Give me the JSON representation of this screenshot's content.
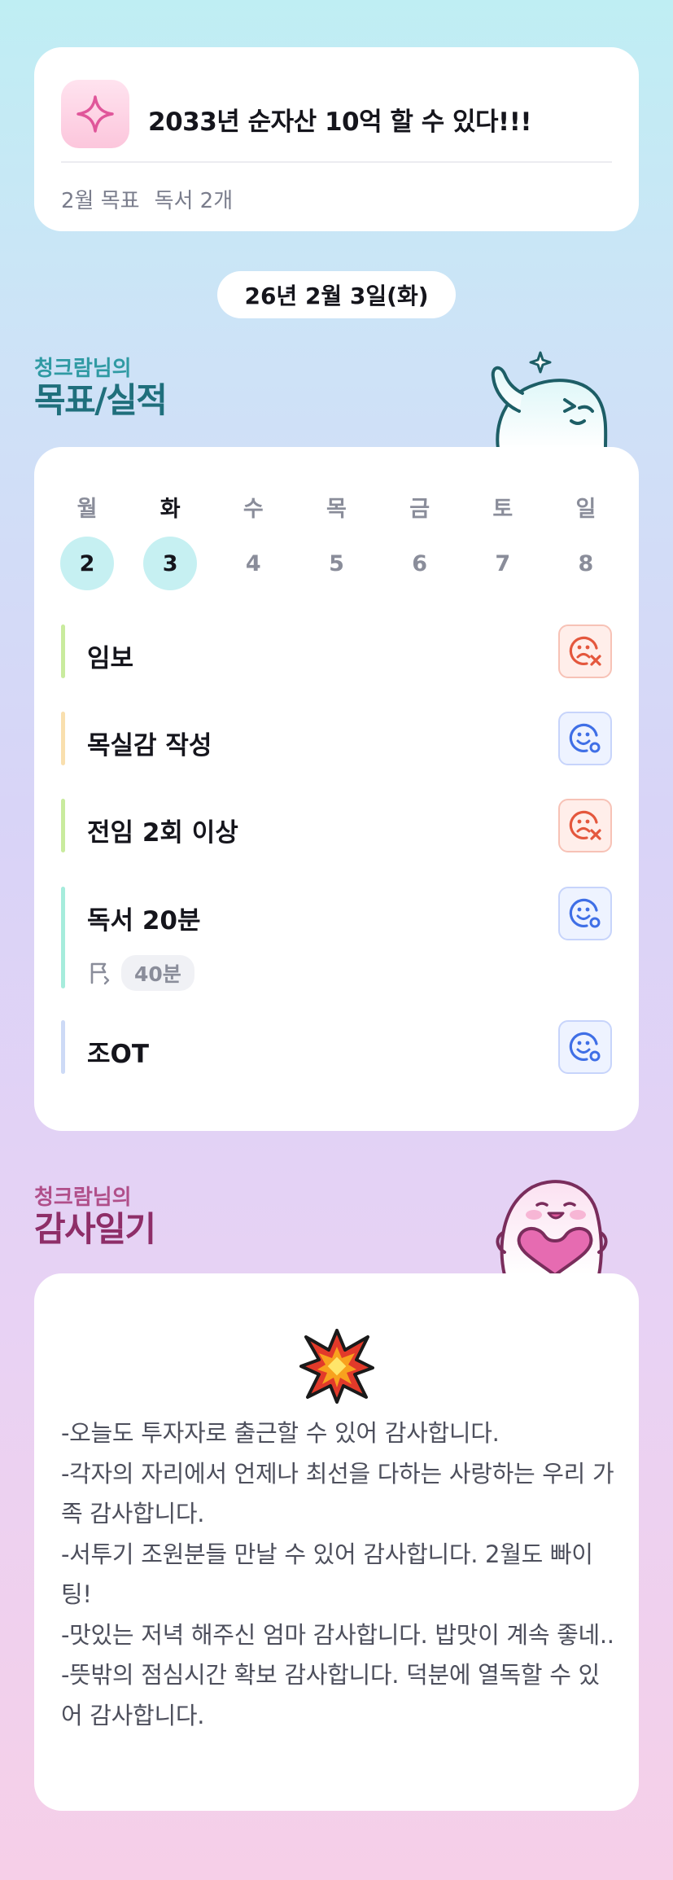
{
  "goal": {
    "title": "2033년 순자산 10억 할 수 있다!!!",
    "month_label": "2월 목표",
    "month_goal": "독서 2개",
    "icon": "sparkle-icon"
  },
  "date_label": "26년 2월 3일(화)",
  "goals_section": {
    "small": "청크람님의",
    "big": "목표/실적"
  },
  "week": [
    {
      "name": "월",
      "num": "2",
      "marked": true,
      "today": false
    },
    {
      "name": "화",
      "num": "3",
      "marked": true,
      "today": true
    },
    {
      "name": "수",
      "num": "4",
      "marked": false,
      "today": false
    },
    {
      "name": "목",
      "num": "5",
      "marked": false,
      "today": false
    },
    {
      "name": "금",
      "num": "6",
      "marked": false,
      "today": false
    },
    {
      "name": "토",
      "num": "7",
      "marked": false,
      "today": false
    },
    {
      "name": "일",
      "num": "8",
      "marked": false,
      "today": false
    }
  ],
  "tasks": [
    {
      "label": "임보",
      "status": "fail",
      "bar_color": "#c9eb9e"
    },
    {
      "label": "목실감 작성",
      "status": "ok",
      "bar_color": "#f9dfae"
    },
    {
      "label": "전임 2회 이상",
      "status": "fail",
      "bar_color": "#c9eb9e"
    },
    {
      "label": "독서 20분",
      "status": "ok",
      "bar_color": "#a6ecdc",
      "target": "40분"
    },
    {
      "label": "조OT",
      "status": "ok",
      "bar_color": "#cddaf6"
    }
  ],
  "colors": {
    "fail": "#e4573d",
    "ok": "#3f6fe6"
  },
  "thanks_section": {
    "small": "청크람님의",
    "big": "감사일기"
  },
  "thanks_lines": [
    "-오늘도 투자자로 출근할 수 있어 감사합니다.",
    "-각자의 자리에서 언제나 최선을 다하는 사랑하는 우리 가족 감사합니다.",
    "-서투기 조원분들 만날 수 있어 감사합니다. 2월도 빠이팅!",
    "-맛있는 저녁 해주신 엄마 감사합니다. 밥맛이 계속 좋네..",
    "-뜻밖의 점심시간 확보 감사합니다. 덕분에 열독할 수 있어 감사합니다."
  ]
}
